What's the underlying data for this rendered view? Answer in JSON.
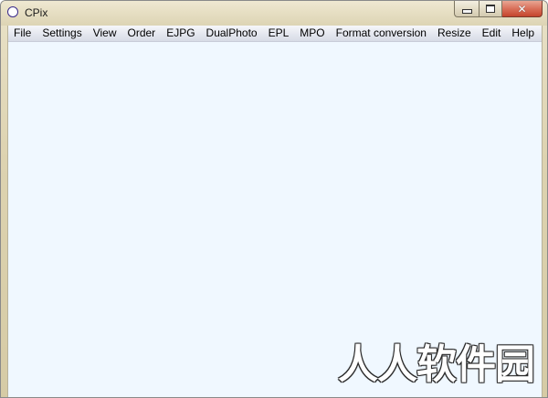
{
  "window": {
    "title": "CPix",
    "icon": "circle-app-icon",
    "controls": [
      "minimize-icon",
      "maximize-icon",
      "close-icon"
    ]
  },
  "menubar": {
    "items": [
      {
        "label": "File"
      },
      {
        "label": "Settings"
      },
      {
        "label": "View"
      },
      {
        "label": "Order"
      },
      {
        "label": "EJPG"
      },
      {
        "label": "DualPhoto"
      },
      {
        "label": "EPL"
      },
      {
        "label": "MPO"
      },
      {
        "label": "Format conversion"
      },
      {
        "label": "Resize"
      },
      {
        "label": "Edit"
      },
      {
        "label": "Help"
      }
    ]
  },
  "watermark": {
    "text": "人人软件园"
  },
  "colors": {
    "client_background": "#f0f8ff",
    "frame": "#ddd3b0",
    "close_button": "#d9705a"
  }
}
